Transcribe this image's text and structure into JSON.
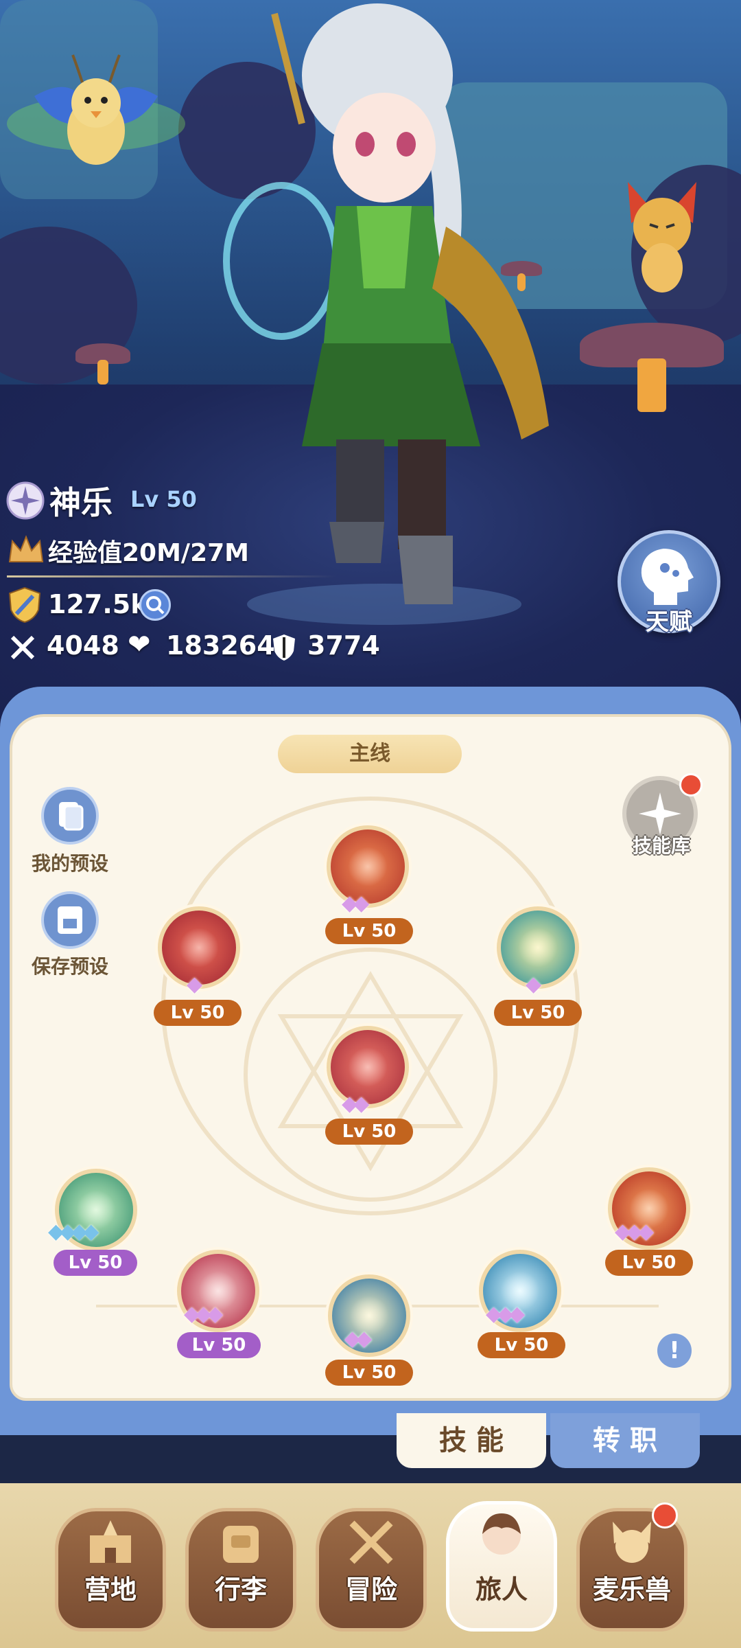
{
  "character": {
    "name": "神乐",
    "level": "Lv 50",
    "exp_label": "经验值20M/27M",
    "power": "127.5k",
    "attack": "4048",
    "hp": "183264",
    "defense": "3774",
    "talent_label": "天赋"
  },
  "panel": {
    "mode_label": "主线",
    "my_presets_label": "我的预设",
    "save_presets_label": "保存预设",
    "skill_library_label": "技能库",
    "info_label": "!"
  },
  "skills": [
    {
      "id": "top",
      "level": "Lv 50",
      "stars": 2,
      "colour": "red"
    },
    {
      "id": "left",
      "level": "Lv 50",
      "stars": 1,
      "colour": "red"
    },
    {
      "id": "right",
      "level": "Lv 50",
      "stars": 1,
      "colour": "teal"
    },
    {
      "id": "center",
      "level": "Lv 50",
      "stars": 2,
      "colour": "red"
    },
    {
      "id": "row-1",
      "level": "Lv 50",
      "stars": 4,
      "colour": "green"
    },
    {
      "id": "row-2",
      "level": "Lv 50",
      "stars": 3,
      "colour": "red"
    },
    {
      "id": "row-3",
      "level": "Lv 50",
      "stars": 2,
      "colour": "blue"
    },
    {
      "id": "row-4",
      "level": "Lv 50",
      "stars": 3,
      "colour": "blue"
    },
    {
      "id": "row-5",
      "level": "Lv 50",
      "stars": 3,
      "colour": "red"
    }
  ],
  "tabs": {
    "skills": "技 能",
    "transfer": "转 职"
  },
  "nav": {
    "camp": "营地",
    "luggage": "行李",
    "adventure": "冒险",
    "traveler": "旅人",
    "pets": "麦乐兽"
  },
  "colors": {
    "panel_bg": "#fbf6ea",
    "frame": "#6e96d8",
    "level_orange": "#c2641e",
    "level_purple": "#a35ec8",
    "badge_red": "#e84d36"
  }
}
